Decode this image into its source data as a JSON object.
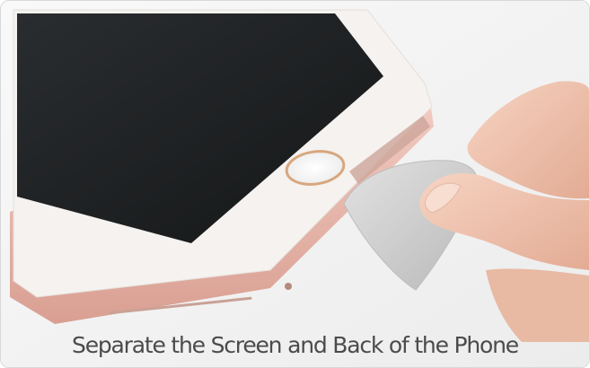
{
  "image": {
    "caption": "Separate the Screen and Back of the Phone",
    "icon": "phone-opening-photo",
    "colors": {
      "screen": "#1f2224",
      "bezel": "#f4f1ee",
      "rose_gold": "#e9b8ad",
      "home_button_ring": "#d7a77f",
      "pick": "#cfcfcf",
      "skin": "#f1c8b3",
      "caption": "#4b4b4b"
    }
  }
}
